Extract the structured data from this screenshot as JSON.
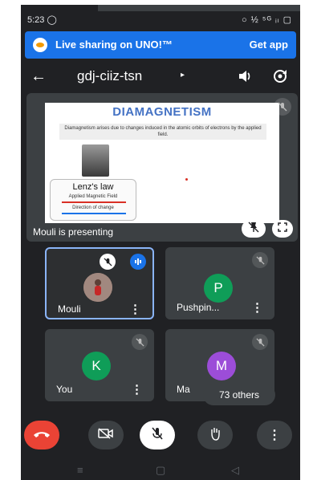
{
  "status": {
    "time": "5:23",
    "notification_icon": "whatsapp-icon",
    "right_icons": "○ ½ ⁵ᴳ ᵢₗ ▢"
  },
  "banner": {
    "text": "Live sharing on UNO!™",
    "action": "Get app",
    "color": "#1a73e8"
  },
  "meeting": {
    "code": "gdj-ciiz-tsn",
    "caret": "▸"
  },
  "presentation": {
    "slide_title": "DIAMAGNETISM",
    "slide_desc": "Diamagnetism arises due to changes induced in the atomic orbits of electrons by the applied field.",
    "law_title": "Lenz's law",
    "law_line1": "Applied Magnetic Field",
    "law_line2": "Direction of change",
    "presenting_label": "Mouli is presenting"
  },
  "participants": [
    {
      "name": "Mouli",
      "initial": "",
      "color": "#8d6e63",
      "speaking": true
    },
    {
      "name": "Pushpin...",
      "initial": "P",
      "color": "#0f9d58",
      "speaking": false
    },
    {
      "name": "You",
      "initial": "K",
      "color": "#0f9d58",
      "speaking": false
    },
    {
      "name": "Ma",
      "initial": "M",
      "color": "#9c4dd8",
      "speaking": false
    }
  ],
  "others_label": "73 others",
  "more_glyph": "⋮",
  "colors": {
    "end_call": "#ea4335",
    "background": "#202124",
    "tile": "#3c4043"
  }
}
